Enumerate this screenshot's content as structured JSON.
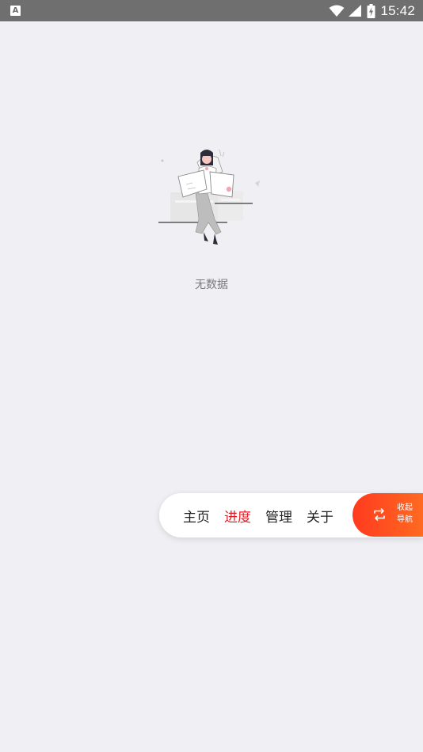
{
  "status_bar": {
    "app_icon_letter": "A",
    "time": "15:42"
  },
  "empty_state": {
    "message": "无数据"
  },
  "nav": {
    "items": [
      {
        "label": "主页",
        "active": false
      },
      {
        "label": "进度",
        "active": true
      },
      {
        "label": "管理",
        "active": false
      },
      {
        "label": "关于",
        "active": false
      }
    ],
    "collapse_label_line1": "收起",
    "collapse_label_line2": "导航"
  },
  "colors": {
    "accent": "#e5191f",
    "button_gradient_start": "#ff3a1f",
    "button_gradient_end": "#ff6a21",
    "background": "#efeff4"
  }
}
